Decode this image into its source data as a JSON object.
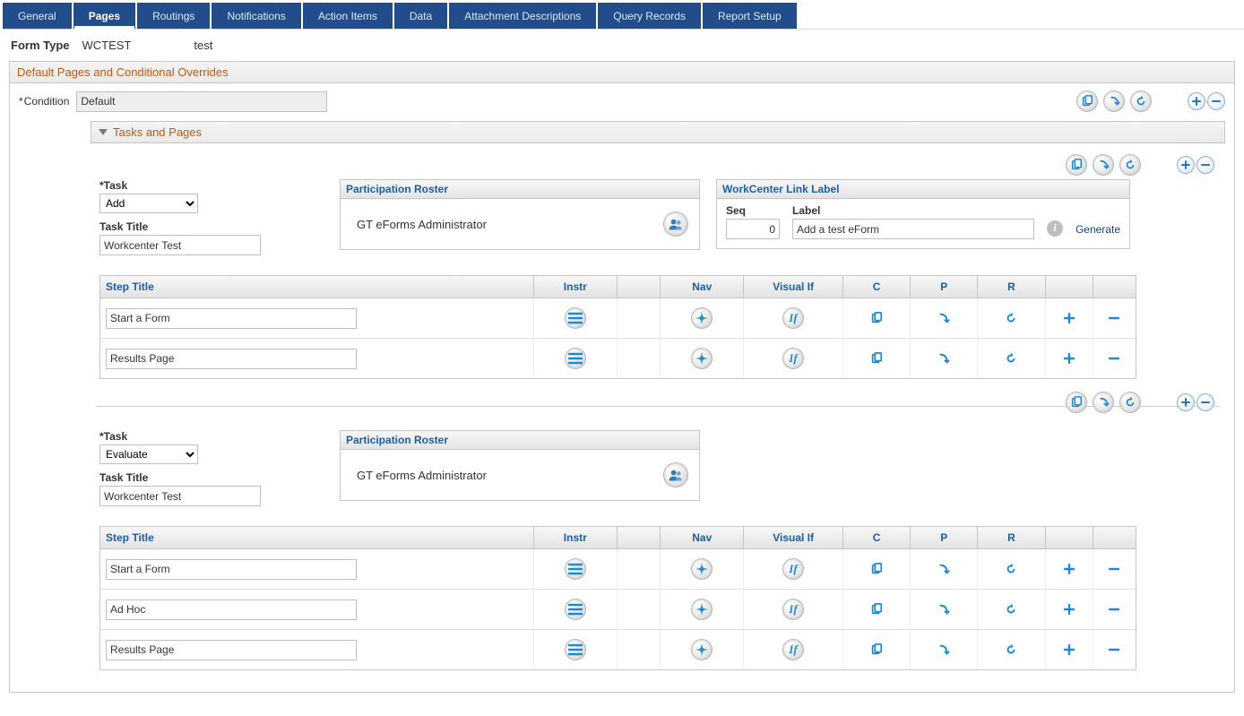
{
  "tabs": [
    "General",
    "Pages",
    "Routings",
    "Notifications",
    "Action Items",
    "Data",
    "Attachment Descriptions",
    "Query Records",
    "Report Setup"
  ],
  "active_tab_index": 1,
  "form_type": {
    "label": "Form Type",
    "code": "WCTEST",
    "desc": "test"
  },
  "group": {
    "title": "Default Pages and Conditional Overrides",
    "condition_label": "Condition",
    "condition_value": "Default"
  },
  "tasks_header": "Tasks and Pages",
  "task_label": "Task",
  "task_title_label": "Task Title",
  "roster_header": "Participation Roster",
  "workcenter_header": "WorkCenter Link Label",
  "seq_label": "Seq",
  "label_label": "Label",
  "generate_label": "Generate",
  "step_headers": {
    "title": "Step Title",
    "instr": "Instr",
    "nav": "Nav",
    "vif": "Visual If",
    "c": "C",
    "p": "P",
    "r": "R"
  },
  "tasks": [
    {
      "task_select": "Add",
      "task_title": "Workcenter Test",
      "roster": "GT eForms Administrator",
      "workcenter": {
        "seq": "0",
        "label": "Add a test eForm"
      },
      "show_workcenter": true,
      "steps": [
        {
          "title": "Start a Form"
        },
        {
          "title": "Results Page"
        }
      ]
    },
    {
      "task_select": "Evaluate",
      "task_title": "Workcenter Test",
      "roster": "GT eForms Administrator",
      "workcenter": null,
      "show_workcenter": false,
      "steps": [
        {
          "title": "Start a Form"
        },
        {
          "title": "Ad Hoc"
        },
        {
          "title": "Results Page"
        }
      ]
    }
  ]
}
